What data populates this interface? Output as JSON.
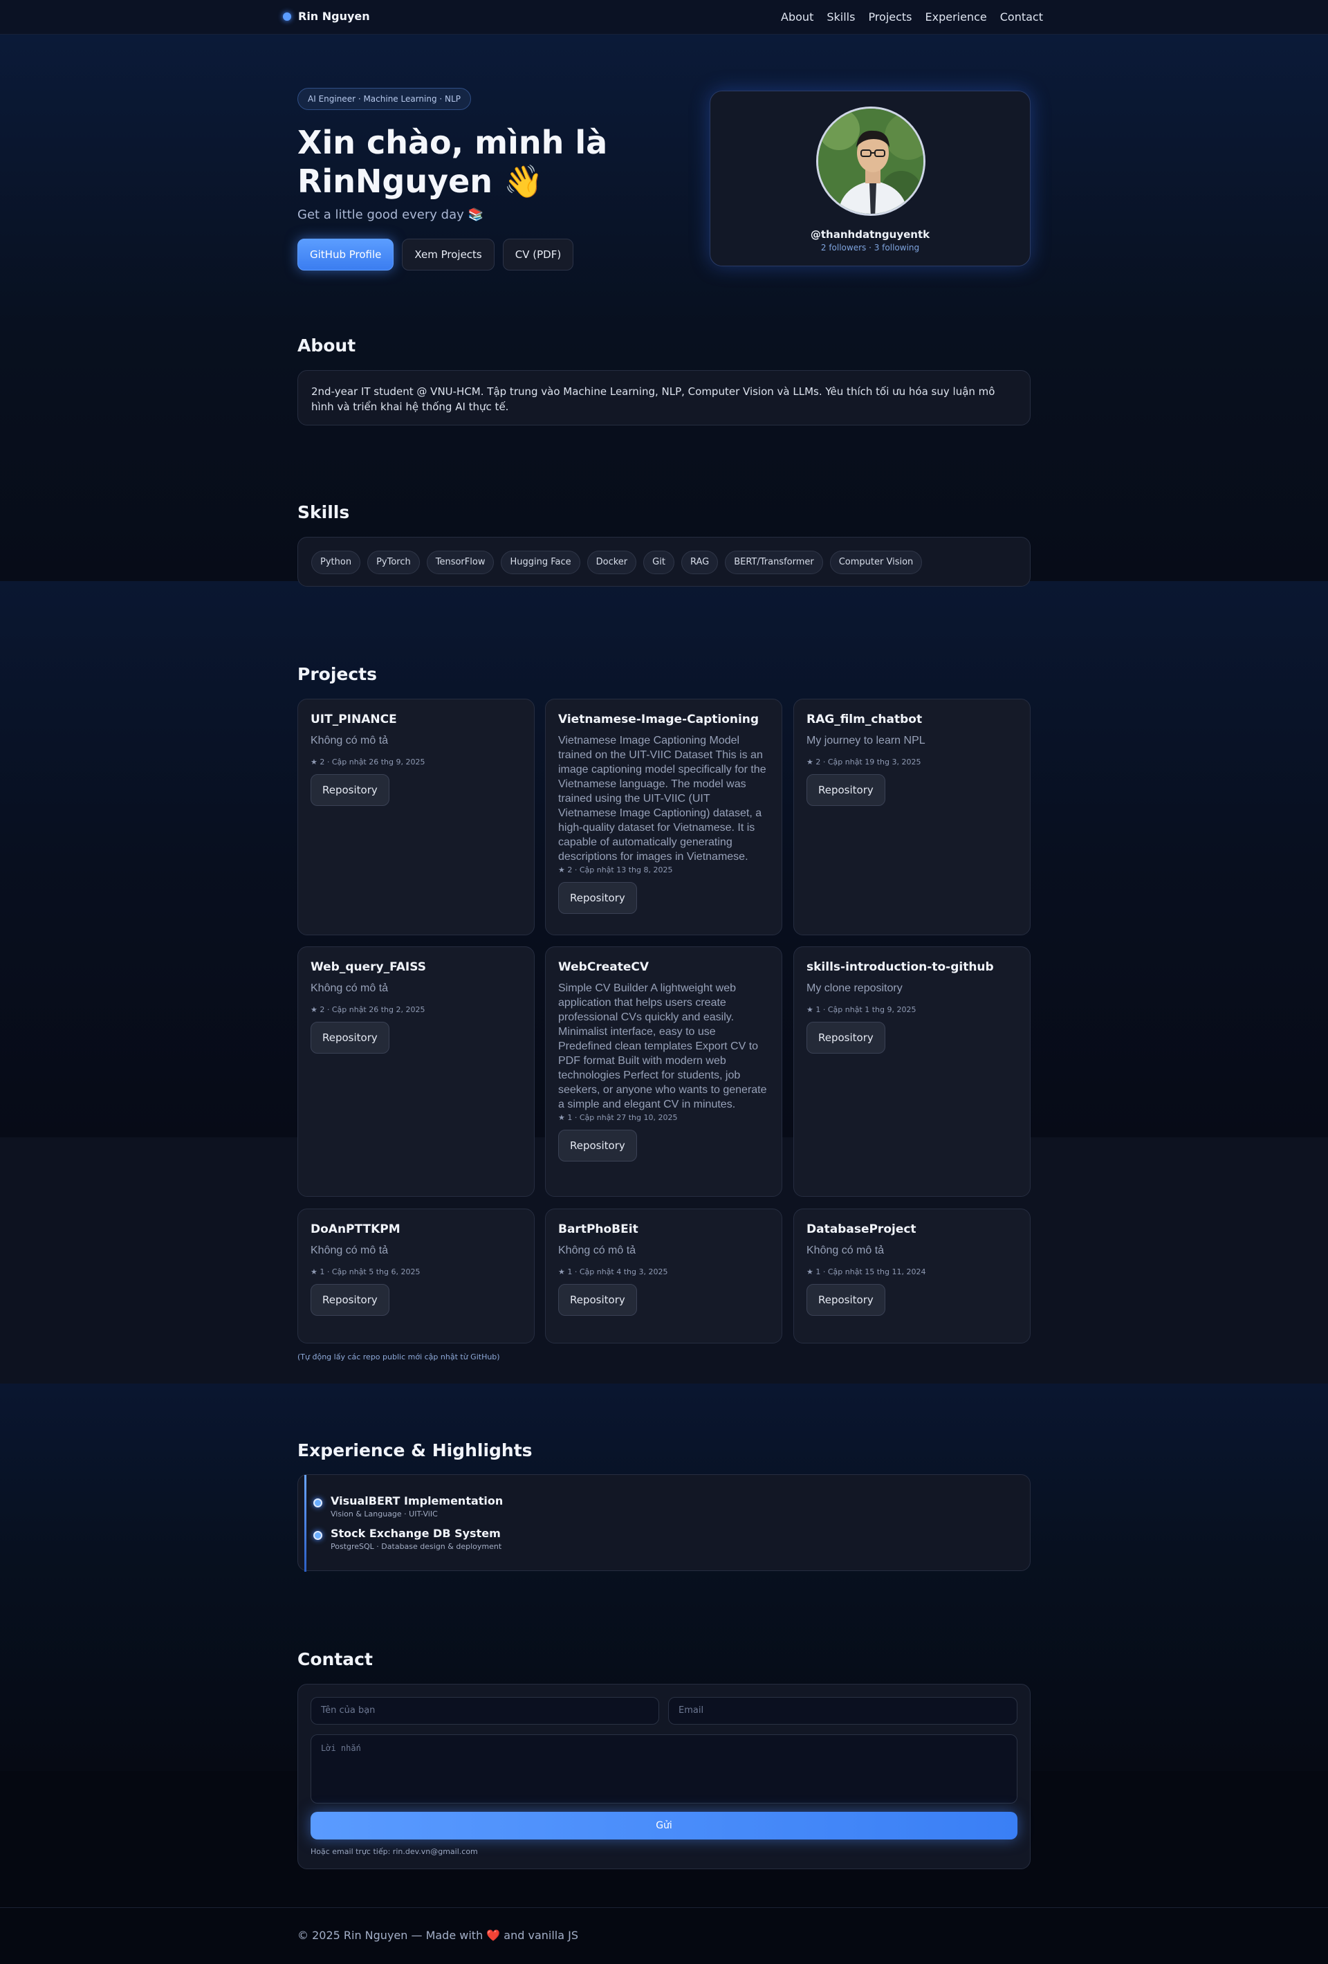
{
  "nav": {
    "brand": "Rin Nguyen",
    "links": [
      "About",
      "Skills",
      "Projects",
      "Experience",
      "Contact"
    ]
  },
  "hero": {
    "badge": "AI Engineer · Machine Learning · NLP",
    "title_line1": "Xin chào, mình là",
    "title_line2": "RinNguyen 👋",
    "subtitle": "Get a little good every day 📚",
    "buttons": [
      "GitHub Profile",
      "Xem Projects",
      "CV (PDF)"
    ]
  },
  "profile": {
    "handle": "@thanhdatnguyentk",
    "stats": "2 followers · 3 following"
  },
  "about": {
    "title": "About",
    "text": "2nd-year IT student @ VNU-HCM. Tập trung vào Machine Learning, NLP, Computer Vision và LLMs. Yêu thích tối ưu hóa suy luận mô hình và triển khai hệ thống AI thực tế."
  },
  "skills": {
    "title": "Skills",
    "items": [
      "Python",
      "PyTorch",
      "TensorFlow",
      "Hugging Face",
      "Docker",
      "Git",
      "RAG",
      "BERT/Transformer",
      "Computer Vision"
    ]
  },
  "projects": {
    "title": "Projects",
    "repo_label": "Repository",
    "items": [
      {
        "name": "UIT_PINANCE",
        "desc": "Không có mô tả",
        "meta": "★ 2 · Cập nhật 26 thg 9, 2025"
      },
      {
        "name": "Vietnamese-Image-Captioning",
        "desc": "Vietnamese Image Captioning Model trained on the UIT-VIIC Dataset This is an image captioning model specifically for the Vietnamese language. The model was trained using the UIT-VIIC (UIT Vietnamese Image Captioning) dataset, a high-quality dataset for Vietnamese. It is capable of automatically generating descriptions for images in Vietnamese.",
        "meta": "★ 2 · Cập nhật 13 thg 8, 2025"
      },
      {
        "name": "RAG_film_chatbot",
        "desc": "My journey to learn NPL",
        "meta": "★ 2 · Cập nhật 19 thg 3, 2025"
      },
      {
        "name": "Web_query_FAISS",
        "desc": "Không có mô tả",
        "meta": "★ 2 · Cập nhật 26 thg 2, 2025"
      },
      {
        "name": "WebCreateCV",
        "desc": "Simple CV Builder A lightweight web application that helps users create professional CVs quickly and easily. Minimalist interface, easy to use Predefined clean templates Export CV to PDF format Built with modern web technologies Perfect for students, job seekers, or anyone who wants to generate a simple and elegant CV in minutes.",
        "meta": "★ 1 · Cập nhật 27 thg 10, 2025"
      },
      {
        "name": "skills-introduction-to-github",
        "desc": "My clone repository",
        "meta": "★ 1 · Cập nhật 1 thg 9, 2025"
      },
      {
        "name": "DoAnPTTKPM",
        "desc": "Không có mô tả",
        "meta": "★ 1 · Cập nhật 5 thg 6, 2025"
      },
      {
        "name": "BartPhoBEit",
        "desc": "Không có mô tả",
        "meta": "★ 1 · Cập nhật 4 thg 3, 2025"
      },
      {
        "name": "DatabaseProject",
        "desc": "Không có mô tả",
        "meta": "★ 1 · Cập nhật 15 thg 11, 2024"
      }
    ],
    "note": "(Tự động lấy các repo public mới cập nhật từ GitHub)"
  },
  "experience": {
    "title": "Experience & Highlights",
    "items": [
      {
        "title": "VisualBERT Implementation",
        "sub": "Vision & Language · UIT-ViIC"
      },
      {
        "title": "Stock Exchange DB System",
        "sub": "PostgreSQL · Database design & deployment"
      }
    ]
  },
  "contact": {
    "title": "Contact",
    "name_placeholder": "Tên của bạn",
    "email_placeholder": "Email",
    "message_placeholder": "Lời nhắn",
    "send_label": "Gửi",
    "mail_note": "Hoặc email trực tiếp: rin.dev.vn@gmail.com"
  },
  "footer": {
    "text": "© 2025 Rin Nguyen — Made with ❤️ and vanilla JS"
  },
  "colors": {
    "accent": "#5b9cff",
    "background": "#070b16",
    "card": "#151a28"
  }
}
